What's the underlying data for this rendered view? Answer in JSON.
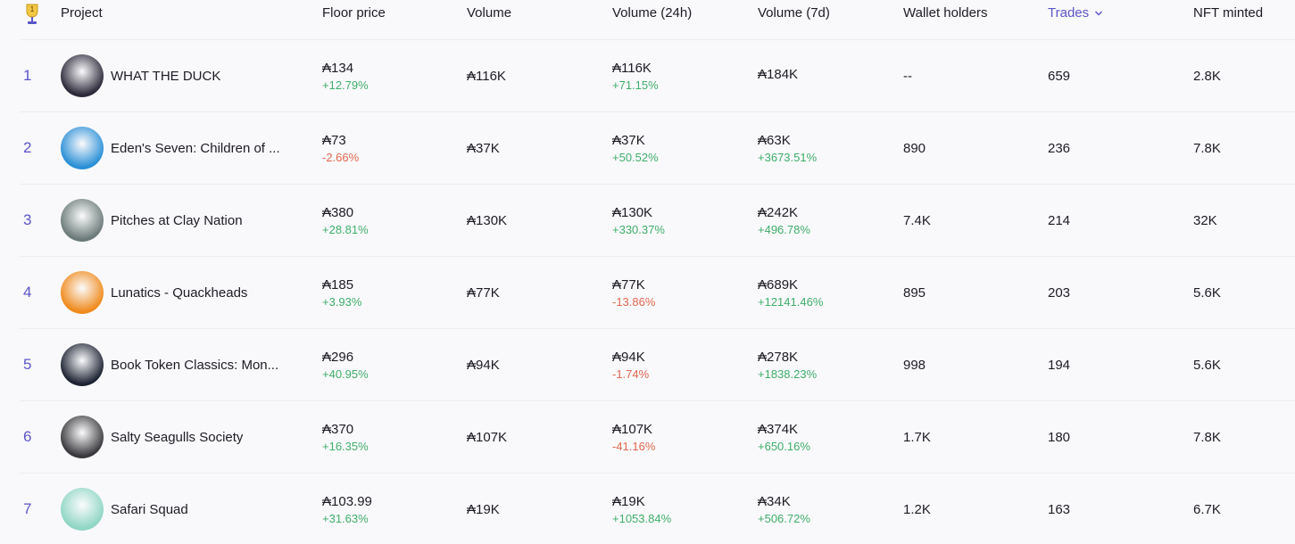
{
  "header": {
    "trophy_badge": "1",
    "project": "Project",
    "floor_price": "Floor price",
    "volume": "Volume",
    "volume_24h": "Volume (24h)",
    "volume_7d": "Volume (7d)",
    "wallet_holders": "Wallet holders",
    "trades": "Trades",
    "nft_minted": "NFT minted"
  },
  "colors": {
    "accent": "#5b55c9",
    "positive": "#3fae69",
    "negative": "#e2674e"
  },
  "rows": [
    {
      "rank": "1",
      "name": "WHAT THE DUCK",
      "avatar_color": "#2c2a3a",
      "floor": "₳134",
      "floor_chg": "+12.79%",
      "floor_sign": "pos",
      "volume": "₳116K",
      "v24": "₳116K",
      "v24_chg": "+71.15%",
      "v24_sign": "pos",
      "v7": "₳184K",
      "v7_chg": "",
      "v7_sign": "pos",
      "holders": "--",
      "trades": "659",
      "minted": "2.8K"
    },
    {
      "rank": "2",
      "name": "Eden's Seven: Children of ...",
      "avatar_color": "#2a8fd6",
      "floor": "₳73",
      "floor_chg": "-2.66%",
      "floor_sign": "neg",
      "volume": "₳37K",
      "v24": "₳37K",
      "v24_chg": "+50.52%",
      "v24_sign": "pos",
      "v7": "₳63K",
      "v7_chg": "+3673.51%",
      "v7_sign": "pos",
      "holders": "890",
      "trades": "236",
      "minted": "7.8K"
    },
    {
      "rank": "3",
      "name": "Pitches at Clay Nation",
      "avatar_color": "#6b7a78",
      "floor": "₳380",
      "floor_chg": "+28.81%",
      "floor_sign": "pos",
      "volume": "₳130K",
      "v24": "₳130K",
      "v24_chg": "+330.37%",
      "v24_sign": "pos",
      "v7": "₳242K",
      "v7_chg": "+496.78%",
      "v7_sign": "pos",
      "holders": "7.4K",
      "trades": "214",
      "minted": "32K"
    },
    {
      "rank": "4",
      "name": "Lunatics - Quackheads",
      "avatar_color": "#f08a1c",
      "floor": "₳185",
      "floor_chg": "+3.93%",
      "floor_sign": "pos",
      "volume": "₳77K",
      "v24": "₳77K",
      "v24_chg": "-13.86%",
      "v24_sign": "neg",
      "v7": "₳689K",
      "v7_chg": "+12141.46%",
      "v7_sign": "pos",
      "holders": "895",
      "trades": "203",
      "minted": "5.6K"
    },
    {
      "rank": "5",
      "name": "Book Token Classics: Mon...",
      "avatar_color": "#1d2333",
      "floor": "₳296",
      "floor_chg": "+40.95%",
      "floor_sign": "pos",
      "volume": "₳94K",
      "v24": "₳94K",
      "v24_chg": "-1.74%",
      "v24_sign": "neg",
      "v7": "₳278K",
      "v7_chg": "+1838.23%",
      "v7_sign": "pos",
      "holders": "998",
      "trades": "194",
      "minted": "5.6K"
    },
    {
      "rank": "6",
      "name": "Salty Seagulls Society",
      "avatar_color": "#3a3a3e",
      "floor": "₳370",
      "floor_chg": "+16.35%",
      "floor_sign": "pos",
      "volume": "₳107K",
      "v24": "₳107K",
      "v24_chg": "-41.16%",
      "v24_sign": "neg",
      "v7": "₳374K",
      "v7_chg": "+650.16%",
      "v7_sign": "pos",
      "holders": "1.7K",
      "trades": "180",
      "minted": "7.8K"
    },
    {
      "rank": "7",
      "name": "Safari Squad",
      "avatar_color": "#8fd6c4",
      "floor": "₳103.99",
      "floor_chg": "+31.63%",
      "floor_sign": "pos",
      "volume": "₳19K",
      "v24": "₳19K",
      "v24_chg": "+1053.84%",
      "v24_sign": "pos",
      "v7": "₳34K",
      "v7_chg": "+506.72%",
      "v7_sign": "pos",
      "holders": "1.2K",
      "trades": "163",
      "minted": "6.7K"
    }
  ]
}
